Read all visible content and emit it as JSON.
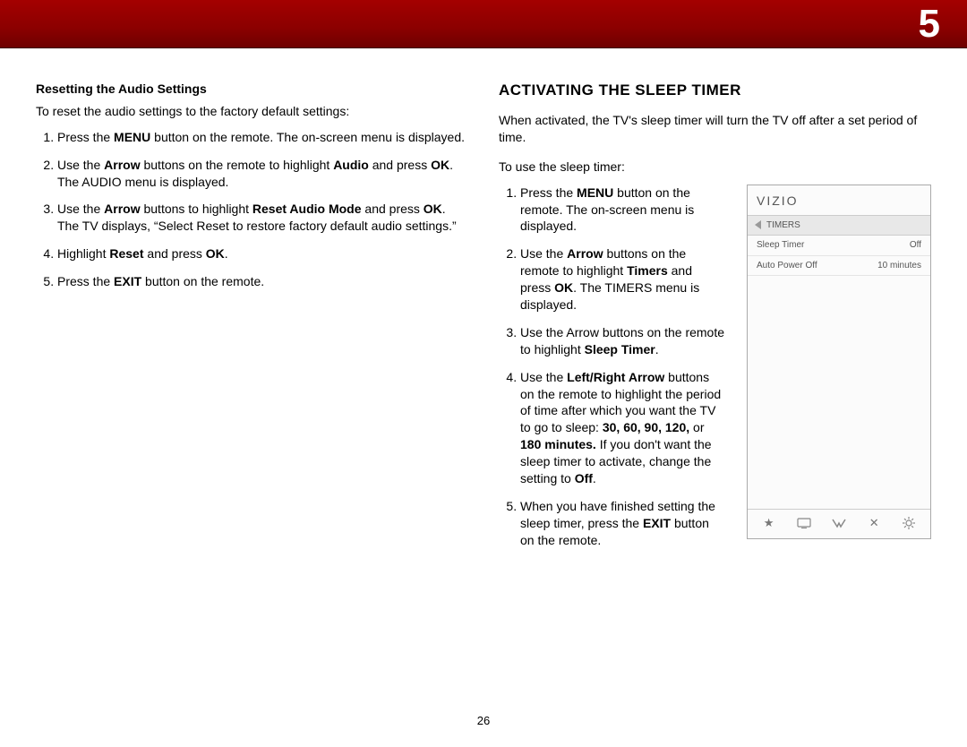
{
  "chapter": "5",
  "page_number": "26",
  "left": {
    "heading": "Resetting the Audio Settings",
    "intro": "To reset the audio settings to the factory default settings:",
    "steps": [
      "Press the <b>MENU</b> button on the remote. The on-screen menu is displayed.",
      "Use the <b>Arrow</b> buttons on the remote to highlight <b>Audio</b> and press <b>OK</b>. The AUDIO menu is displayed.",
      "Use the <b>Arrow</b> buttons to highlight <b>Reset Audio Mode</b> and press <b>OK</b>. The TV displays, “Select Reset to restore factory default audio settings.”",
      "Highlight <b>Reset</b> and press <b>OK</b>.",
      "Press the <b>EXIT</b> button on the remote."
    ]
  },
  "right": {
    "title": "ACTIVATING THE SLEEP TIMER",
    "intro": "When activated, the TV's sleep timer will turn the TV off after a set period of time.",
    "lead": "To use the sleep timer:",
    "steps": [
      "Press the <b>MENU</b> button on the remote. The on-screen menu is displayed.",
      "Use the <b>Arrow</b> buttons on the remote to highlight <b>Timers</b> and press <b>OK</b>. The TIMERS menu is displayed.",
      "Use the Arrow buttons on the remote to highlight <b>Sleep Timer</b>.",
      "Use the <b>Left/Right Arrow</b> buttons on the remote to highlight the period of time after which you want the TV to go to sleep: <b>30, 60, 90, 120,</b> or <b>180 minutes.</b> If you don't want the sleep timer to activate, change the setting to <b>Off</b>.",
      "When you have finished setting the sleep timer, press the <b>EXIT</b> button on the remote."
    ]
  },
  "osd": {
    "brand": "VIZIO",
    "crumb": "TIMERS",
    "rows": [
      {
        "label": "Sleep Timer",
        "value": "Off"
      },
      {
        "label": "Auto Power Off",
        "value": "10 minutes"
      }
    ],
    "footer_icons": [
      "star",
      "tv",
      "v",
      "x",
      "gear"
    ]
  }
}
